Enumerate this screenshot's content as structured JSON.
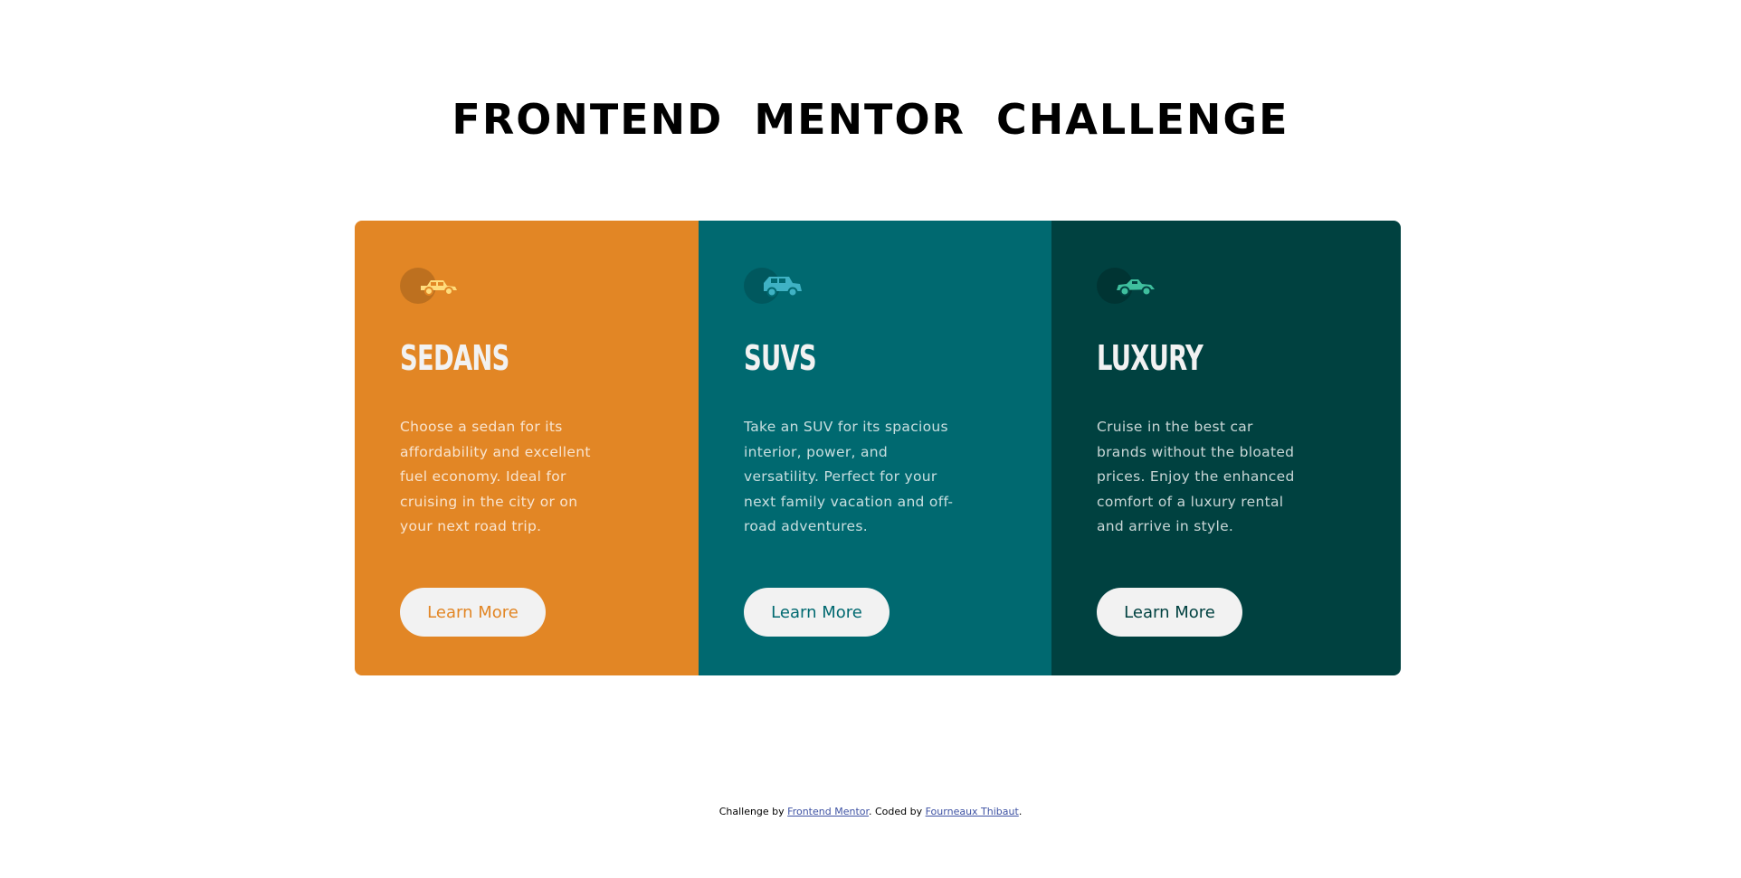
{
  "title": "FRONTEND MENTOR CHALLENGE",
  "cards": [
    {
      "heading": "SEDANS",
      "text": "Choose a sedan for its affordability and excellent fuel economy. Ideal for cruising in the city or on your next road trip.",
      "button_label": "Learn More",
      "icon": "sedan-icon",
      "background_color": "#e28625",
      "accent_color": "#e28625"
    },
    {
      "heading": "SUVS",
      "text": "Take an SUV for its spacious interior, power, and versatility. Perfect for your next family vacation and off-road adventures.",
      "button_label": "Learn More",
      "icon": "suv-icon",
      "background_color": "#006970",
      "accent_color": "#006970"
    },
    {
      "heading": "LUXURY",
      "text": "Cruise in the best car brands without the bloated prices. Enjoy the enhanced comfort of a luxury rental and arrive in style.",
      "button_label": "Learn More",
      "icon": "luxury-car-icon",
      "background_color": "#004140",
      "accent_color": "#004140"
    }
  ],
  "footer": {
    "prefix": "Challenge by ",
    "link1": "Frontend Mentor",
    "middle": ". Coded by ",
    "link2": "Fourneaux Thibaut",
    "suffix": "."
  }
}
